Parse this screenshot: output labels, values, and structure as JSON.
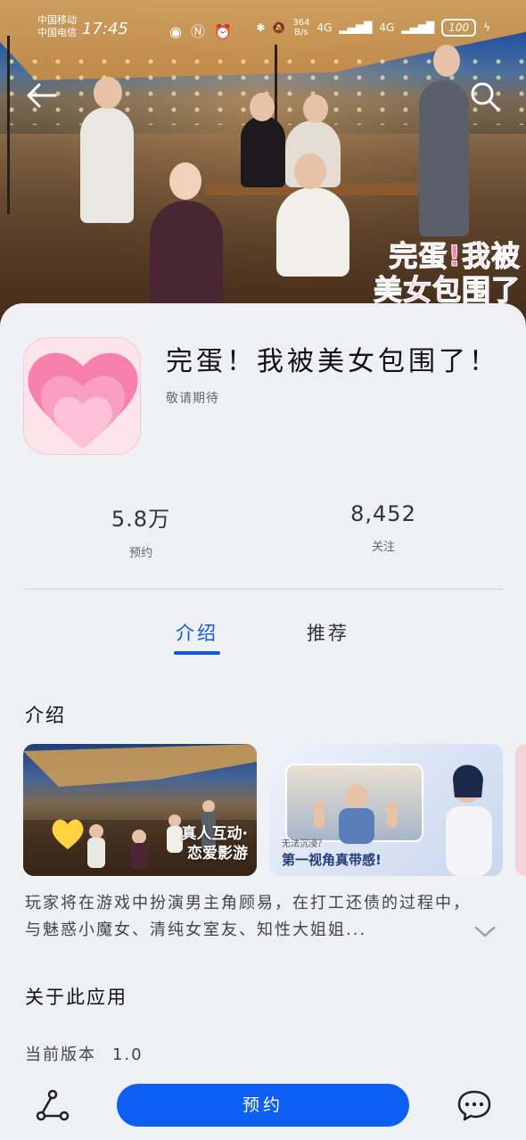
{
  "status_bar": {
    "carrier_1": "中国移动",
    "carrier_2": "中国电信",
    "time": "17:45",
    "net_speed_value": "364",
    "net_speed_unit": "B/s",
    "signal_1": "4G",
    "signal_2": "4G",
    "battery": "100"
  },
  "hero": {
    "overlay_line_1": "完蛋!我被",
    "overlay_line_2": "美女包围了"
  },
  "app": {
    "title": "完蛋！我被美女包围了！",
    "subtitle": "敬请期待"
  },
  "stats": [
    {
      "value": "5.8万",
      "label": "预约"
    },
    {
      "value": "8,452",
      "label": "关注"
    }
  ],
  "tabs": [
    {
      "label": "介绍",
      "active": true
    },
    {
      "label": "推荐",
      "active": false
    }
  ],
  "intro": {
    "heading": "介绍",
    "screenshot_1_caption_line_1": "真人互动·",
    "screenshot_1_caption_line_2": "恋爱影游",
    "screenshot_2_caption_top": "无法沉浸？",
    "screenshot_2_caption": "第一视角真带感!",
    "description": "玩家将在游戏中扮演男主角顾易，在打工还债的过程中，与魅惑小魔女、清纯女室友、知性大姐姐..."
  },
  "about": {
    "heading": "关于此应用",
    "version_label": "当前版本",
    "version_value": "1.0"
  },
  "bottom_bar": {
    "reserve_label": "预约"
  },
  "colors": {
    "accent": "#1559d6",
    "button": "#0c5ef5",
    "hero_text": "#ff7fb5",
    "icon_bg": "#fde3ea"
  },
  "icons": {
    "back": "arrow-left-icon",
    "search": "search-icon",
    "expand": "chevron-down-icon",
    "share": "share-icon",
    "chat": "chat-icon"
  }
}
